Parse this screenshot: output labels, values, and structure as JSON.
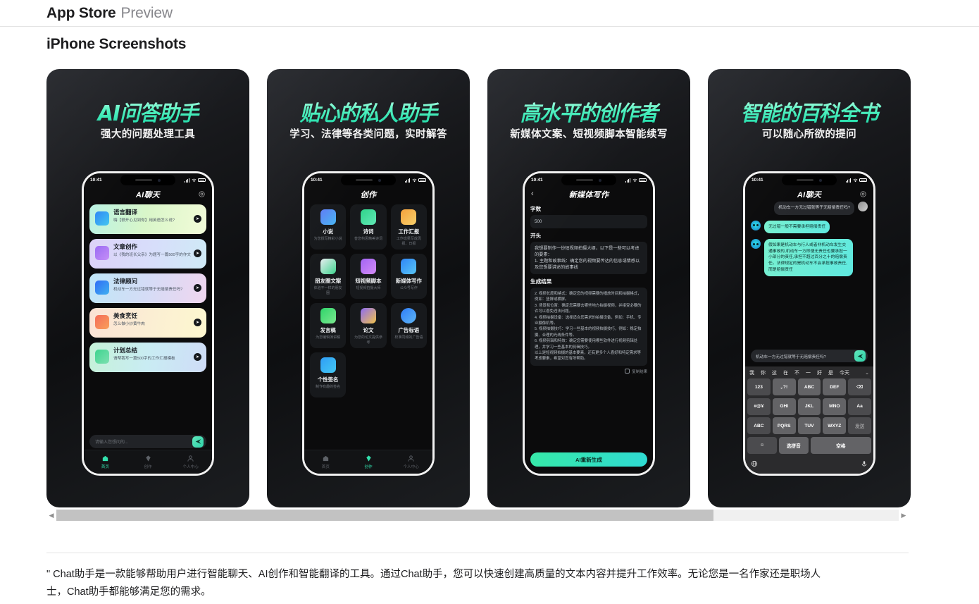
{
  "header": {
    "brand": "App Store",
    "subtitle": "Preview"
  },
  "section": {
    "title": "iPhone Screenshots"
  },
  "statusbar": {
    "time": "10:41"
  },
  "shots": [
    {
      "headline": "AI问答助手",
      "subhead": "强大的问题处理工具",
      "app_title": "AI聊天",
      "cards": [
        {
          "title": "语言翻译",
          "desc": "嗨【很开心见到你】用英语怎么说?",
          "arrow": "➤"
        },
        {
          "title": "文章创作",
          "desc": "以《我的班长父亲》为题写一篇500字的作文",
          "arrow": "➤"
        },
        {
          "title": "法律顾问",
          "desc": "机动车一方无过错就等于无赔偿责任吗?",
          "arrow": "➤"
        },
        {
          "title": "美食烹饪",
          "desc": "怎么做小炒黄牛肉",
          "arrow": "➤"
        },
        {
          "title": "计划总结",
          "desc": "请帮我写一篇500字的工作汇报模板",
          "arrow": "➤"
        }
      ],
      "input_placeholder": "请输入您想问的...",
      "tabs": [
        {
          "label": "首页",
          "active": true
        },
        {
          "label": "创作",
          "active": false
        },
        {
          "label": "个人中心",
          "active": false
        }
      ]
    },
    {
      "headline": "贴心的私人助手",
      "subhead": "学习、法律等各类问题，实时解答",
      "app_title": "创作",
      "grid": [
        {
          "title": "小说",
          "desc": "为您撰写精彩小说"
        },
        {
          "title": "诗词",
          "desc": "替您构思精美诗词"
        },
        {
          "title": "工作汇报",
          "desc": "工作成果写成周报、日报"
        },
        {
          "title": "朋友圈文案",
          "desc": "体验不一样的朋友圈"
        },
        {
          "title": "短视频脚本",
          "desc": "短视频拍摄大师"
        },
        {
          "title": "新媒体写作",
          "desc": "公众号写作"
        },
        {
          "title": "发言稿",
          "desc": "为您编辑演讲稿"
        },
        {
          "title": "论文",
          "desc": "为您的论文提供参考"
        },
        {
          "title": "广告标语",
          "desc": "校准同频的广告语"
        },
        {
          "title": "个性签名",
          "desc": "制作有趣的签名"
        }
      ],
      "tabs": [
        {
          "label": "首页",
          "active": false
        },
        {
          "label": "创作",
          "active": true
        },
        {
          "label": "个人中心",
          "active": false
        }
      ]
    },
    {
      "headline": "高水平的创作者",
      "subhead": "新媒体文案、短视频脚本智能续写",
      "app_title": "新媒体写作",
      "back_icon": "‹",
      "form": {
        "count_label": "字数",
        "count_value": "500",
        "start_label": "开头",
        "start_value": "我想要制作一份短视频拍摄大纲，以下是一些可以考虑的要素：\n1. 主题和故事线：确定您的视频要传达的信息或情感以及您想要讲述的故事线",
        "result_label": "生成结果",
        "result_value": "2. 视频长度和格式：确定您的视频需要的播放时间和拍摄格式，例如：竖屏或横屏。\n3. 场景和位置：确定您需要去哪些地方拍摄视频，并接受必要的许可以避免违法问题。\n4. 视频拍摄设备：选择适合您需求的拍摄设备，例如：手机、专业摄像机等。\n5. 视频拍摄技巧：学习一些基本的视频拍摄技巧，例如：稳定拍摄、合理的光线条件等。\n6. 视频剪辑和特效：确定您需要使用哪些软件进行视频剪辑处理，并学习一些基本的剪辑技巧。\n以上是短视频拍摄的基本要素，还有更多个人喜好和特定需求等考虑要素，希望对您有所帮助。",
        "copy_label": "复制结果",
        "regen_label": "AI重新生成"
      }
    },
    {
      "headline": "智能的百科全书",
      "subhead": "可以随心所欲的提问",
      "app_title": "AI聊天",
      "messages": [
        {
          "from": "me",
          "text": "机动车一方无过错就等于无赔偿责任吗?"
        },
        {
          "from": "bot",
          "text": "无过错一般不需要承担赔偿责任"
        },
        {
          "from": "bot",
          "text": "假如果是机动车与行人或者非机动车发生交通事故的,机动车一方即便无责任也要承担一小部分的责任,承担不超过百分之十的赔偿责任。法律规定的是机动车不会承担事故责任,而是赔偿责任"
        }
      ],
      "input_value": "机动车一方无过错就等于无赔偿责任吗?",
      "keyboard": {
        "suggestions": [
          "我",
          "你",
          "这",
          "在",
          "不",
          "一",
          "好",
          "是",
          "今天"
        ],
        "chevron": "⌄",
        "rows": [
          [
            "123",
            ",.?!",
            "ABC",
            "DEF",
            "⌫"
          ],
          [
            "#@¥",
            "GHI",
            "JKL",
            "MNO",
            "Aa"
          ],
          [
            "ABC",
            "PQRS",
            "TUV",
            "WXYZ",
            "发送"
          ],
          [
            "☺",
            "选拼音",
            "空格"
          ]
        ]
      }
    }
  ],
  "scrollbar": {
    "left_arrow": "◀",
    "right_arrow": "▶"
  },
  "description": "\" Chat助手是一款能够帮助用户进行智能聊天、AI创作和智能翻译的工具。通过Chat助手，您可以快速创建高质量的文本内容并提升工作效率。无论您是一名作家还是职场人士，Chat助手都能够满足您的需求。"
}
